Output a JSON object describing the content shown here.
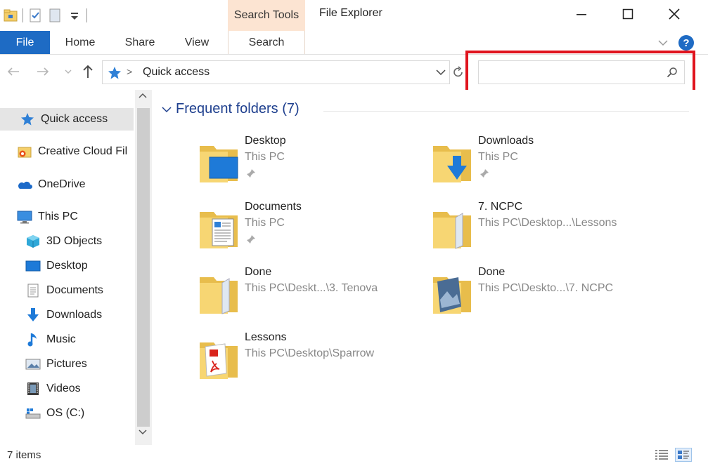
{
  "window": {
    "title": "File Explorer",
    "contextual_tab_group": "Search Tools"
  },
  "ribbon": {
    "tabs": [
      {
        "label": "File"
      },
      {
        "label": "Home"
      },
      {
        "label": "Share"
      },
      {
        "label": "View"
      },
      {
        "label": "Search"
      }
    ],
    "help_label": "?"
  },
  "address": {
    "separator": ">",
    "location": "Quick access"
  },
  "search": {
    "value": "",
    "placeholder": ""
  },
  "nav_pane": {
    "items": [
      {
        "label": "Quick access",
        "icon": "pin-star-icon",
        "selected": true
      },
      {
        "label": "Creative Cloud Fil",
        "icon": "creative-cloud-icon"
      },
      {
        "label": "OneDrive",
        "icon": "onedrive-icon"
      },
      {
        "label": "This PC",
        "icon": "this-pc-icon"
      },
      {
        "label": "3D Objects",
        "icon": "3d-objects-icon"
      },
      {
        "label": "Desktop",
        "icon": "desktop-icon"
      },
      {
        "label": "Documents",
        "icon": "documents-icon"
      },
      {
        "label": "Downloads",
        "icon": "downloads-icon"
      },
      {
        "label": "Music",
        "icon": "music-icon"
      },
      {
        "label": "Pictures",
        "icon": "pictures-icon"
      },
      {
        "label": "Videos",
        "icon": "videos-icon"
      },
      {
        "label": "OS (C:)",
        "icon": "drive-icon"
      }
    ]
  },
  "content": {
    "group_header": "Frequent folders (7)",
    "folders": [
      {
        "name": "Desktop",
        "path": "This PC",
        "pinned": true,
        "icon": "desktop-folder-icon"
      },
      {
        "name": "Downloads",
        "path": "This PC",
        "pinned": true,
        "icon": "downloads-folder-icon"
      },
      {
        "name": "Documents",
        "path": "This PC",
        "pinned": true,
        "icon": "documents-folder-icon"
      },
      {
        "name": "7. NCPC",
        "path": "This PC\\Desktop...\\Lessons",
        "pinned": false,
        "icon": "folder-icon"
      },
      {
        "name": "Done",
        "path": "This PC\\Deskt...\\3. Tenova",
        "pinned": false,
        "icon": "folder-icon"
      },
      {
        "name": "Done",
        "path": "This PC\\Deskto...\\7. NCPC",
        "pinned": false,
        "icon": "photo-folder-icon"
      },
      {
        "name": "Lessons",
        "path": "This PC\\Desktop\\Sparrow",
        "pinned": false,
        "icon": "pdf-folder-icon"
      }
    ]
  },
  "status": {
    "item_count": "7 items"
  },
  "colors": {
    "accent": "#1e6bc4",
    "contextual_tab": "#fce4d2",
    "group_header": "#1e3f8e",
    "highlight_box": "#e0141e",
    "folder_yellow": "#f5cf6a"
  }
}
